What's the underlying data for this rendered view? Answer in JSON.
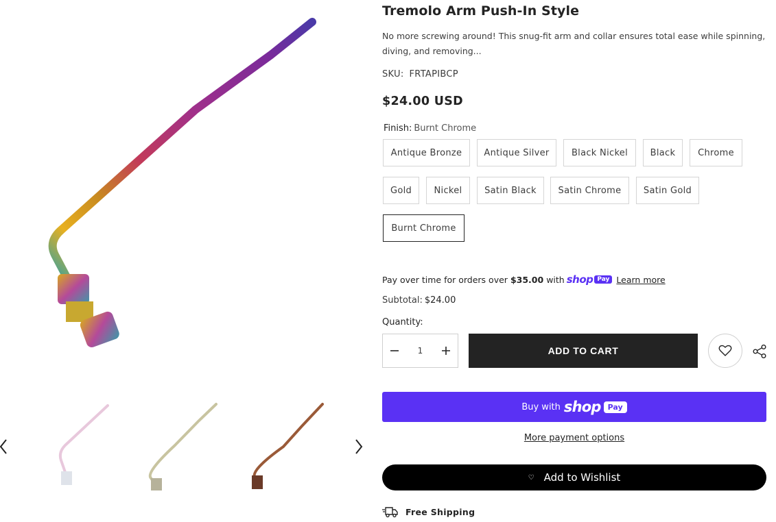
{
  "product": {
    "title": "Tremolo Arm Push-In Style",
    "description": "No more screwing around! This snug-fit arm and collar ensures total ease while spinning, diving, and removing...",
    "sku_label": "SKU:",
    "sku_value": "FRTAPIBCP",
    "price": "$24.00 USD",
    "finish_label": "Finish:",
    "finish_selected": "Burnt Chrome",
    "finish_options": [
      "Antique Bronze",
      "Antique Silver",
      "Black Nickel",
      "Black",
      "Chrome",
      "Gold",
      "Nickel",
      "Satin Black",
      "Satin Chrome",
      "Satin Gold",
      "Burnt Chrome"
    ]
  },
  "payment": {
    "installments_prefix": "Pay over time for orders over",
    "installments_amount": "$35.00",
    "installments_with": "with",
    "shop_word": "shop",
    "pay_word": "Pay",
    "learn_more": "Learn more",
    "subtotal_label": "Subtotal:",
    "subtotal_value": "$24.00",
    "buy_with": "Buy with",
    "more_options": "More payment options"
  },
  "cart": {
    "quantity_label": "Quantity:",
    "quantity_value": "1",
    "add_to_cart": "ADD TO CART",
    "add_to_wishlist": "Add to Wishlist"
  },
  "shipping": {
    "free_shipping": "Free Shipping"
  },
  "gallery": {
    "thumbnails": [
      "arm-chrome-pink",
      "arm-nickel",
      "arm-bronze"
    ]
  },
  "colors": {
    "shop_pay": "#5a31f4",
    "dark": "#232323"
  }
}
